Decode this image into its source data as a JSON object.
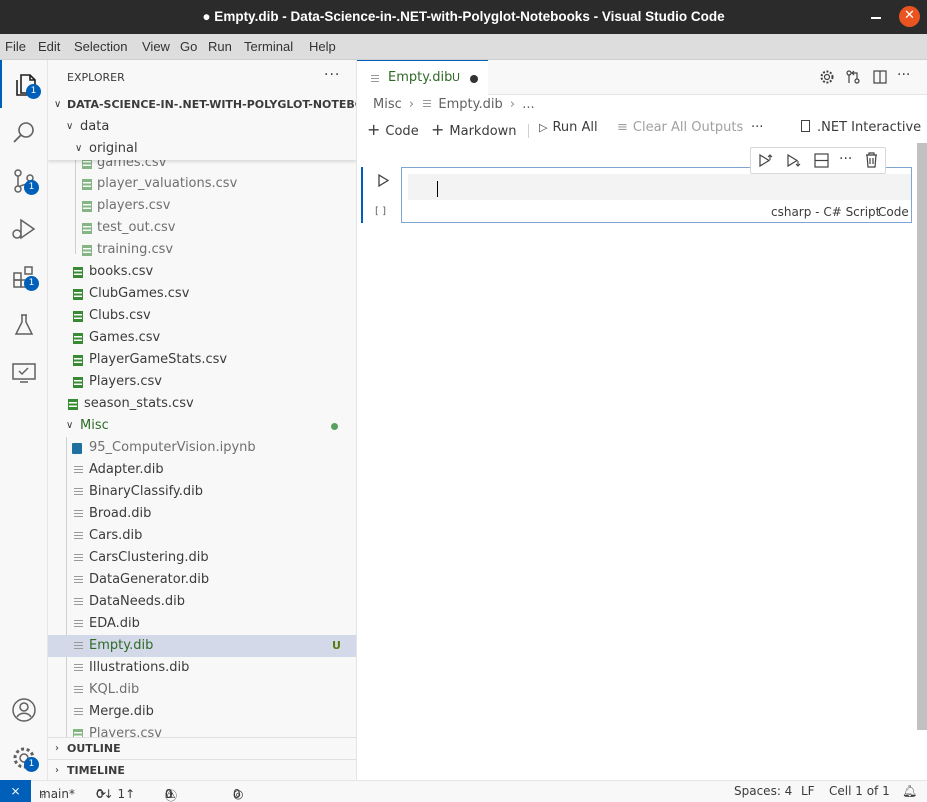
{
  "window": {
    "title": "● Empty.dib - Data-Science-in-.NET-with-Polyglot-Notebooks - Visual Studio Code",
    "close_glyph": "✕"
  },
  "menu": [
    "File",
    "Edit",
    "Selection",
    "View",
    "Go",
    "Run",
    "Terminal",
    "Help"
  ],
  "activity_bar": {
    "items": [
      {
        "name": "explorer-icon",
        "badge": "1"
      },
      {
        "name": "search-icon",
        "badge": null
      },
      {
        "name": "source-control-icon",
        "badge": "1"
      },
      {
        "name": "run-debug-icon",
        "badge": null
      },
      {
        "name": "extensions-icon",
        "badge": "1"
      },
      {
        "name": "testing-icon",
        "badge": null
      },
      {
        "name": "remote-explorer-icon",
        "badge": null
      }
    ],
    "manage_badge": "1"
  },
  "sidebar": {
    "header": "EXPLORER",
    "more": "···",
    "root": "DATA-SCIENCE-IN-.NET-WITH-POLYGLOT-NOTEBOOKS",
    "folder_data": "data",
    "folder_original": "original",
    "original_files": [
      "games.csv",
      "player_valuations.csv",
      "players.csv",
      "test_out.csv",
      "training.csv"
    ],
    "data_files": [
      "books.csv",
      "ClubGames.csv",
      "Clubs.csv",
      "Games.csv",
      "PlayerGameStats.csv",
      "Players.csv",
      "season_stats.csv"
    ],
    "folder_misc": "Misc",
    "misc_files": [
      {
        "name": "95_ComputerVision.ipynb",
        "kind": "notebook",
        "dim": true
      },
      {
        "name": "Adapter.dib",
        "kind": "dib"
      },
      {
        "name": "BinaryClassify.dib",
        "kind": "dib"
      },
      {
        "name": "Broad.dib",
        "kind": "dib"
      },
      {
        "name": "Cars.dib",
        "kind": "dib"
      },
      {
        "name": "CarsClustering.dib",
        "kind": "dib"
      },
      {
        "name": "DataGenerator.dib",
        "kind": "dib"
      },
      {
        "name": "DataNeeds.dib",
        "kind": "dib"
      },
      {
        "name": "EDA.dib",
        "kind": "dib"
      },
      {
        "name": "Empty.dib",
        "kind": "dib",
        "selected": true,
        "status": "U"
      },
      {
        "name": "Illustrations.dib",
        "kind": "dib"
      },
      {
        "name": "KQL.dib",
        "kind": "dib",
        "dim": true
      },
      {
        "name": "Merge.dib",
        "kind": "dib"
      },
      {
        "name": "Players.csv",
        "kind": "csv",
        "dim": true
      }
    ],
    "outline": "OUTLINE",
    "timeline": "TIMELINE"
  },
  "editor": {
    "tab": {
      "name": "Empty.dib",
      "status": "U"
    },
    "breadcrumb": {
      "folder": "Misc",
      "file": "Empty.dib",
      "more": "..."
    },
    "toolbar": {
      "code": "Code",
      "markdown": "Markdown",
      "run_all": "Run All",
      "clear_outputs": "Clear All Outputs",
      "more": "···",
      "kernel": ".NET Interactive"
    },
    "cell": {
      "execution_count": "[ ]",
      "language": "csharp - C# Script",
      "kind": "Code",
      "content": ""
    }
  },
  "status_bar": {
    "remote": "⨯",
    "branch": "main*",
    "sync": "0↓ 1↑",
    "errors": "0",
    "warnings": "0",
    "ports": "0",
    "spaces": "Spaces: 4",
    "eol": "LF",
    "cell_pos": "Cell 1 of 1"
  }
}
